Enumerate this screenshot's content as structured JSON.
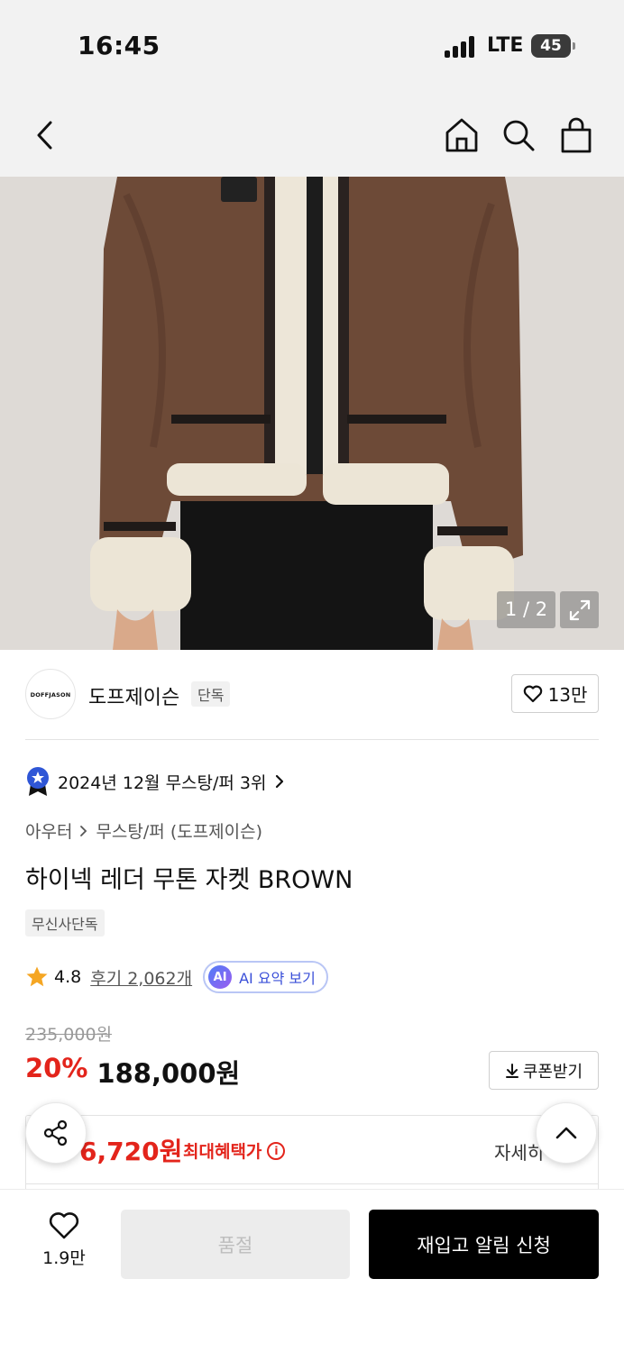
{
  "status_bar": {
    "time": "16:45",
    "network": "LTE",
    "battery": "45"
  },
  "nav": {
    "back_icon": "chevron-left-icon",
    "home_icon": "home-icon",
    "search_icon": "search-icon",
    "cart_icon": "shopping-bag-icon"
  },
  "gallery": {
    "counter": "1 / 2",
    "expand_icon": "expand-icon"
  },
  "brand": {
    "logo_text": "DOFFJASON",
    "name": "도프제이슨",
    "tag": "단독",
    "likes": "13만"
  },
  "ranking": {
    "text": "2024년 12월 무스탕/퍼 3위",
    "badge_icon": "ranking-badge-icon"
  },
  "breadcrumb": {
    "category": "아우터",
    "subcategory": "무스탕/퍼 (도프제이슨)"
  },
  "product": {
    "title": "하이넥 레더 무톤 자켓 BROWN",
    "exclusive_tag": "무신사단독"
  },
  "rating": {
    "score": "4.8",
    "reviews": "후기 2,062개",
    "ai_badge": "AI",
    "ai_label": "AI 요약 보기"
  },
  "price": {
    "original": "235,000원",
    "discount": "20%",
    "sale": "188,000원",
    "coupon_label": "쿠폰받기"
  },
  "benefit": {
    "price": "6,720원",
    "label": "최대혜택가",
    "detail": "자세히"
  },
  "bottom_bar": {
    "wish_count": "1.9만",
    "soldout_label": "품절",
    "restock_label": "재입고 알림 신청"
  },
  "colors": {
    "accent_red": "#e3241b",
    "ai_blue": "#3a4fd8",
    "button_black": "#000000"
  }
}
